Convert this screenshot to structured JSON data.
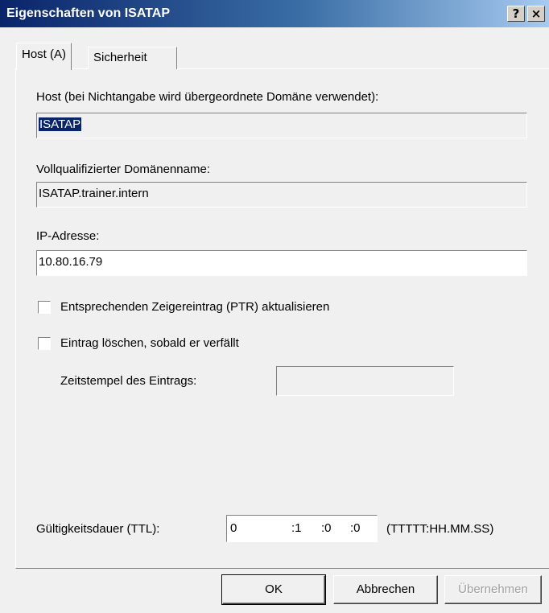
{
  "window": {
    "title": "Eigenschaften von ISATAP",
    "help_glyph": "?",
    "close_glyph": "×"
  },
  "tabs": [
    {
      "label": "Host (A)",
      "active": true
    },
    {
      "label": "Sicherheit",
      "active": false
    }
  ],
  "host": {
    "label": "Host (bei Nichtangabe wird übergeordnete Domäne verwendet):",
    "value": "ISATAP"
  },
  "fqdn": {
    "label": "Vollqualifizierter Domänenname:",
    "value": "ISATAP.trainer.intern"
  },
  "ip": {
    "label": "IP-Adresse:",
    "value": "10.80.16.79"
  },
  "options": {
    "ptr_label": "Entsprechenden Zeigereintrag (PTR) aktualisieren",
    "ptr_checked": false,
    "delete_label": "Eintrag löschen, sobald er verfällt",
    "delete_checked": false,
    "timestamp_label": "Zeitstempel des Eintrags:",
    "timestamp_value": ""
  },
  "ttl": {
    "label": "Gültigkeitsdauer (TTL):",
    "days": "0",
    "hours": ":1",
    "minutes": ":0",
    "seconds": ":0",
    "format": "(TTTTT:HH.MM.SS)"
  },
  "buttons": {
    "ok": "OK",
    "cancel": "Abbrechen",
    "apply": "Übernehmen"
  }
}
